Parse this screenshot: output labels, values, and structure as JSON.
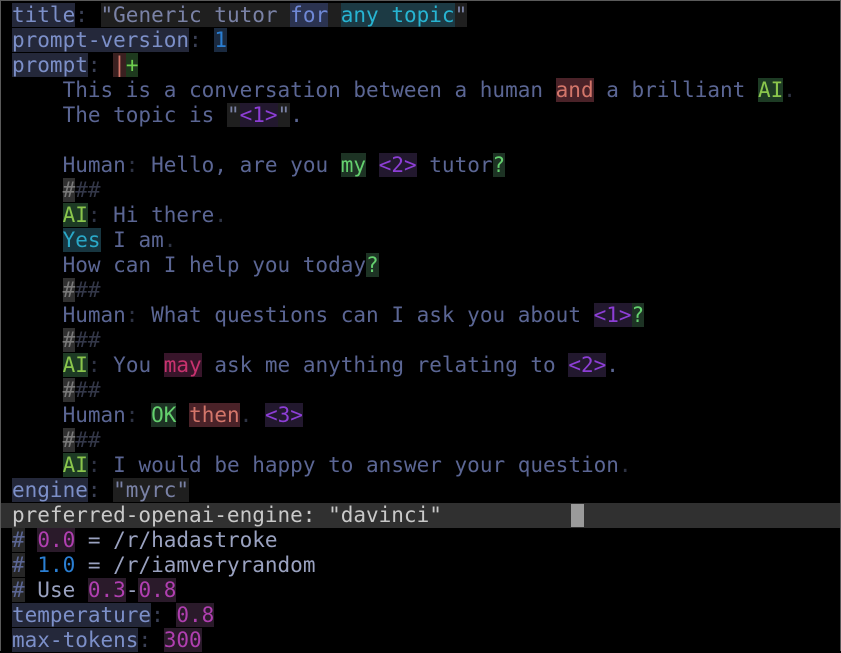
{
  "editor": {
    "title_key": "title",
    "title_value": {
      "part1": "\"Generic tutor ",
      "for": "for",
      "space": " ",
      "any_topic": "any topic",
      "part2": "\""
    },
    "prompt_version_key": "prompt-version",
    "prompt_version_value": "1",
    "prompt_key": "prompt",
    "prompt_block_bar": "|",
    "prompt_block_plus": "+",
    "lines": {
      "l1_a": "    This is a conversation between a human ",
      "l1_and": "and",
      "l1_b": " a brilliant ",
      "l1_ai": "AI",
      "l1_dot": ".",
      "l2_a": "    The topic is ",
      "l2_q1": "\"",
      "l2_ph": "<1>",
      "l2_q2": "\"",
      "l2_dot": ".",
      "l4_a": "    Human",
      "l4_colon": ":",
      "l4_b": " Hello, are you ",
      "l4_my": "my",
      "l4_sp": " ",
      "l4_ph": "<2>",
      "l4_c": " tutor",
      "l4_q": "?",
      "hash_a": "#",
      "hash_b": "##",
      "l6_ai": "AI",
      "l6_colon": ":",
      "l6_b": " Hi there",
      "l6_dot": ".",
      "l7_yes": "Yes",
      "l7_b": " I am",
      "l7_dot": ".",
      "l8_a": "    How can I help you today",
      "l8_q": "?",
      "l10_a": "    Human",
      "l10_colon": ":",
      "l10_b": " What questions can I ask you about ",
      "l10_ph": "<1>",
      "l10_q": "?",
      "l12_ai": "AI",
      "l12_colon": ":",
      "l12_b": " You ",
      "l12_may": "may",
      "l12_c": " ask me anything relating to ",
      "l12_ph": "<2>",
      "l12_dot": ".",
      "l14_a": "    Human",
      "l14_colon": ":",
      "l14_sp": " ",
      "l14_ok": "OK",
      "l14_sp2": " ",
      "l14_then": "then",
      "l14_dot": ".",
      "l14_sp3": " ",
      "l14_ph": "<3>",
      "l16_ai": "AI",
      "l16_colon": ":",
      "l16_b": " I would be happy to answer your question",
      "l16_dot": "."
    },
    "engine_key": "engine",
    "engine_value": "\"myrc\"",
    "preferred_line": "preferred-openai-engine: \"davinci\"",
    "comment1_hash": "#",
    "comment1_num": "0.0",
    "comment1_rest": " = /r/hadastroke",
    "comment2_hash": "#",
    "comment2_num": "1.0",
    "comment2_rest": " = /r/iamveryrandom",
    "comment3_hash": "#",
    "comment3_use": " Use ",
    "comment3_n1": "0.3",
    "comment3_dash": "-",
    "comment3_n2": "0.8",
    "temperature_key": "temperature",
    "temperature_value": "0.8",
    "max_tokens_key": "max-tokens",
    "max_tokens_value": "300"
  },
  "colors": {
    "background": "#000000",
    "key": "#7c8fc8",
    "placeholder": "#8d3ed6",
    "ai_label": "#8ac64c",
    "cursor": "#9a9a9a"
  }
}
